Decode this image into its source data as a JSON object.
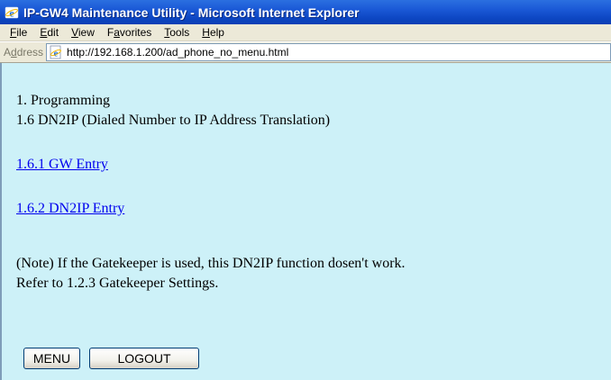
{
  "window": {
    "title": "IP-GW4 Maintenance Utility - Microsoft Internet Explorer",
    "app_icon": "ie-icon"
  },
  "menubar": {
    "items": [
      {
        "label": "File",
        "accel": "F",
        "rest": "ile"
      },
      {
        "label": "Edit",
        "accel": "E",
        "rest": "dit"
      },
      {
        "label": "View",
        "accel": "V",
        "rest": "iew"
      },
      {
        "label": "Favorites",
        "pre": "F",
        "accel": "a",
        "rest": "vorites"
      },
      {
        "label": "Tools",
        "accel": "T",
        "rest": "ools"
      },
      {
        "label": "Help",
        "accel": "H",
        "rest": "elp"
      }
    ]
  },
  "addressbar": {
    "label_pre": "A",
    "label_accel": "d",
    "label_rest": "dress",
    "url": "http://192.168.1.200/ad_phone_no_menu.html",
    "icon": "ie-page-icon"
  },
  "content": {
    "section": "1. Programming",
    "subsection": "1.6 DN2IP (Dialed Number to IP Address Translation)",
    "links": [
      {
        "label": "1.6.1 GW Entry"
      },
      {
        "label": "1.6.2 DN2IP Entry"
      }
    ],
    "note_line1": "(Note) If the Gatekeeper is used, this DN2IP function dosen't work.",
    "note_line2": "Refer to 1.2.3 Gatekeeper Settings.",
    "buttons": {
      "menu": "MENU",
      "logout": "LOGOUT"
    },
    "background_color": "#cdf1f8",
    "link_color": "#0000ee"
  }
}
